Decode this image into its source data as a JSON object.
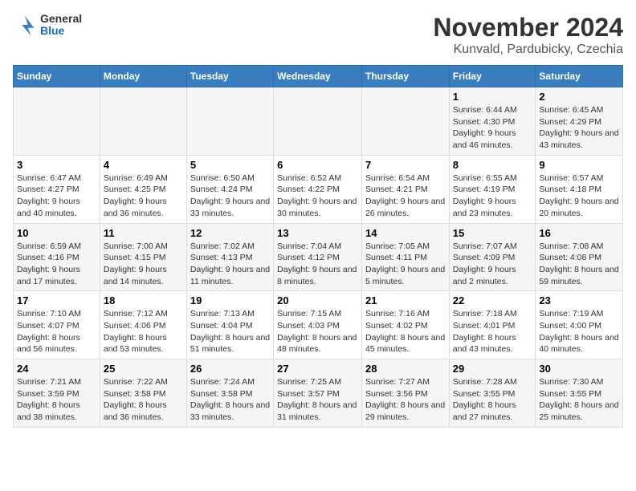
{
  "header": {
    "logo_general": "General",
    "logo_blue": "Blue",
    "title": "November 2024",
    "subtitle": "Kunvald, Pardubicky, Czechia"
  },
  "columns": [
    "Sunday",
    "Monday",
    "Tuesday",
    "Wednesday",
    "Thursday",
    "Friday",
    "Saturday"
  ],
  "weeks": [
    {
      "days": [
        {
          "num": "",
          "info": ""
        },
        {
          "num": "",
          "info": ""
        },
        {
          "num": "",
          "info": ""
        },
        {
          "num": "",
          "info": ""
        },
        {
          "num": "",
          "info": ""
        },
        {
          "num": "1",
          "info": "Sunrise: 6:44 AM\nSunset: 4:30 PM\nDaylight: 9 hours and 46 minutes."
        },
        {
          "num": "2",
          "info": "Sunrise: 6:45 AM\nSunset: 4:29 PM\nDaylight: 9 hours and 43 minutes."
        }
      ]
    },
    {
      "days": [
        {
          "num": "3",
          "info": "Sunrise: 6:47 AM\nSunset: 4:27 PM\nDaylight: 9 hours and 40 minutes."
        },
        {
          "num": "4",
          "info": "Sunrise: 6:49 AM\nSunset: 4:25 PM\nDaylight: 9 hours and 36 minutes."
        },
        {
          "num": "5",
          "info": "Sunrise: 6:50 AM\nSunset: 4:24 PM\nDaylight: 9 hours and 33 minutes."
        },
        {
          "num": "6",
          "info": "Sunrise: 6:52 AM\nSunset: 4:22 PM\nDaylight: 9 hours and 30 minutes."
        },
        {
          "num": "7",
          "info": "Sunrise: 6:54 AM\nSunset: 4:21 PM\nDaylight: 9 hours and 26 minutes."
        },
        {
          "num": "8",
          "info": "Sunrise: 6:55 AM\nSunset: 4:19 PM\nDaylight: 9 hours and 23 minutes."
        },
        {
          "num": "9",
          "info": "Sunrise: 6:57 AM\nSunset: 4:18 PM\nDaylight: 9 hours and 20 minutes."
        }
      ]
    },
    {
      "days": [
        {
          "num": "10",
          "info": "Sunrise: 6:59 AM\nSunset: 4:16 PM\nDaylight: 9 hours and 17 minutes."
        },
        {
          "num": "11",
          "info": "Sunrise: 7:00 AM\nSunset: 4:15 PM\nDaylight: 9 hours and 14 minutes."
        },
        {
          "num": "12",
          "info": "Sunrise: 7:02 AM\nSunset: 4:13 PM\nDaylight: 9 hours and 11 minutes."
        },
        {
          "num": "13",
          "info": "Sunrise: 7:04 AM\nSunset: 4:12 PM\nDaylight: 9 hours and 8 minutes."
        },
        {
          "num": "14",
          "info": "Sunrise: 7:05 AM\nSunset: 4:11 PM\nDaylight: 9 hours and 5 minutes."
        },
        {
          "num": "15",
          "info": "Sunrise: 7:07 AM\nSunset: 4:09 PM\nDaylight: 9 hours and 2 minutes."
        },
        {
          "num": "16",
          "info": "Sunrise: 7:08 AM\nSunset: 4:08 PM\nDaylight: 8 hours and 59 minutes."
        }
      ]
    },
    {
      "days": [
        {
          "num": "17",
          "info": "Sunrise: 7:10 AM\nSunset: 4:07 PM\nDaylight: 8 hours and 56 minutes."
        },
        {
          "num": "18",
          "info": "Sunrise: 7:12 AM\nSunset: 4:06 PM\nDaylight: 8 hours and 53 minutes."
        },
        {
          "num": "19",
          "info": "Sunrise: 7:13 AM\nSunset: 4:04 PM\nDaylight: 8 hours and 51 minutes."
        },
        {
          "num": "20",
          "info": "Sunrise: 7:15 AM\nSunset: 4:03 PM\nDaylight: 8 hours and 48 minutes."
        },
        {
          "num": "21",
          "info": "Sunrise: 7:16 AM\nSunset: 4:02 PM\nDaylight: 8 hours and 45 minutes."
        },
        {
          "num": "22",
          "info": "Sunrise: 7:18 AM\nSunset: 4:01 PM\nDaylight: 8 hours and 43 minutes."
        },
        {
          "num": "23",
          "info": "Sunrise: 7:19 AM\nSunset: 4:00 PM\nDaylight: 8 hours and 40 minutes."
        }
      ]
    },
    {
      "days": [
        {
          "num": "24",
          "info": "Sunrise: 7:21 AM\nSunset: 3:59 PM\nDaylight: 8 hours and 38 minutes."
        },
        {
          "num": "25",
          "info": "Sunrise: 7:22 AM\nSunset: 3:58 PM\nDaylight: 8 hours and 36 minutes."
        },
        {
          "num": "26",
          "info": "Sunrise: 7:24 AM\nSunset: 3:58 PM\nDaylight: 8 hours and 33 minutes."
        },
        {
          "num": "27",
          "info": "Sunrise: 7:25 AM\nSunset: 3:57 PM\nDaylight: 8 hours and 31 minutes."
        },
        {
          "num": "28",
          "info": "Sunrise: 7:27 AM\nSunset: 3:56 PM\nDaylight: 8 hours and 29 minutes."
        },
        {
          "num": "29",
          "info": "Sunrise: 7:28 AM\nSunset: 3:55 PM\nDaylight: 8 hours and 27 minutes."
        },
        {
          "num": "30",
          "info": "Sunrise: 7:30 AM\nSunset: 3:55 PM\nDaylight: 8 hours and 25 minutes."
        }
      ]
    }
  ]
}
